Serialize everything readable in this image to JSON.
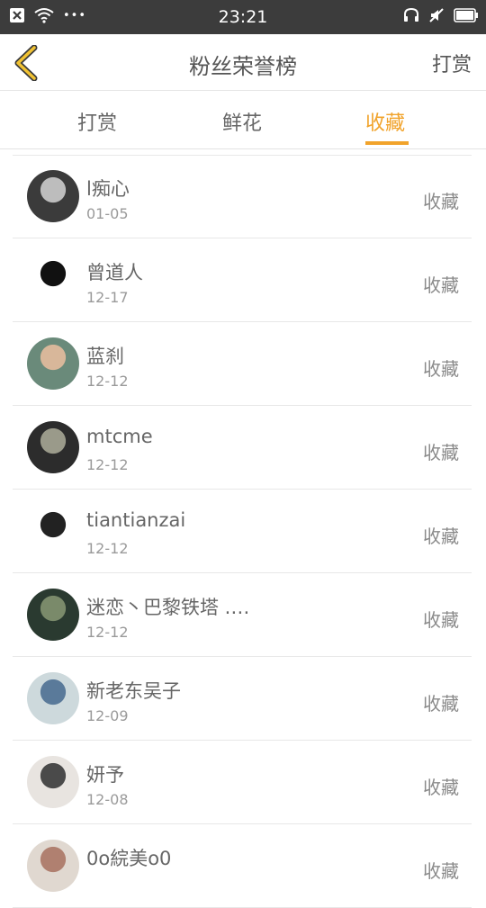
{
  "status_bar": {
    "time": "23:21",
    "left_icons": [
      "notification-x-icon",
      "wifi-icon",
      "more-dots-icon"
    ],
    "right_icons": [
      "headset-icon",
      "mute-icon",
      "battery-icon"
    ],
    "more_dots": "•••"
  },
  "header": {
    "title": "粉丝荣誉榜",
    "back_icon": "chevron-left-icon",
    "action_label": "打赏",
    "accent_color": "#f1a32b"
  },
  "tabs": [
    {
      "label": "打赏",
      "active": false
    },
    {
      "label": "鲜花",
      "active": false
    },
    {
      "label": "收藏",
      "active": true
    }
  ],
  "fans": [
    {
      "name": "l痴心",
      "date": "01-05",
      "type": "收藏",
      "avatar": [
        "#3b3b3b",
        "#bdbdbd"
      ]
    },
    {
      "name": "曾道人",
      "date": "12-17",
      "type": "收藏",
      "avatar": [
        "#ffffff",
        "#111111"
      ]
    },
    {
      "name": "蓝刹",
      "date": "12-12",
      "type": "收藏",
      "avatar": [
        "#6a8a7a",
        "#d8b79a"
      ]
    },
    {
      "name": "mtcme",
      "date": "12-12",
      "type": "收藏",
      "avatar": [
        "#2c2c2c",
        "#9a9a8a"
      ]
    },
    {
      "name": "tiantianzai",
      "date": "12-12",
      "type": "收藏",
      "avatar": [
        "#ffffff",
        "#222222"
      ]
    },
    {
      "name": "迷恋丶巴黎铁塔 .…",
      "date": "12-12",
      "type": "收藏",
      "avatar": [
        "#2a3a30",
        "#7a8a6a"
      ]
    },
    {
      "name": "新老东吴子",
      "date": "12-09",
      "type": "收藏",
      "avatar": [
        "#cdd9dc",
        "#5a7a9a"
      ]
    },
    {
      "name": "妍予",
      "date": "12-08",
      "type": "收藏",
      "avatar": [
        "#e8e4e0",
        "#4a4a4a"
      ]
    },
    {
      "name": "0o綄美o0",
      "date": "",
      "type": "收藏",
      "avatar": [
        "#e0d8d0",
        "#b08070"
      ]
    }
  ]
}
